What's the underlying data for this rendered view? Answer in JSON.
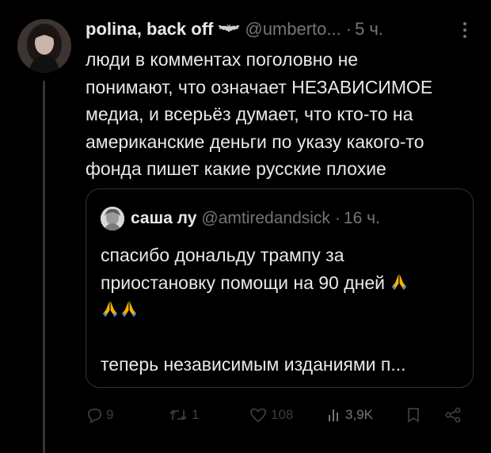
{
  "tweet": {
    "author_name": "polina, back off",
    "author_emoji": "bat-emoji",
    "author_handle": "@umberto...",
    "separator": "·",
    "time": "5 ч.",
    "lines": [
      "люди в комментах поголовно не",
      "понимают, что означает НЕЗАВИСИМОЕ",
      "медиа, и всерьёз думает, что кто-то на",
      "американские деньги по указу какого-то",
      "фонда пишет какие русские плохие"
    ]
  },
  "quote": {
    "author_name": "саша лу",
    "author_handle": "@amtiredandsick",
    "separator": "·",
    "time": "16 ч.",
    "line1": "спасибо дональду трампу за",
    "line2": "приостановку помощи на 90 дней",
    "line4": "теперь независимым изданиями п..."
  },
  "actions": {
    "replies": "9",
    "retweets": "1",
    "likes": "108",
    "views": "3,9K"
  },
  "colors": {
    "background": "#000000",
    "text": "#e7e9ea",
    "muted": "#71767b",
    "border": "#2f3336",
    "thread_line": "#333639"
  }
}
